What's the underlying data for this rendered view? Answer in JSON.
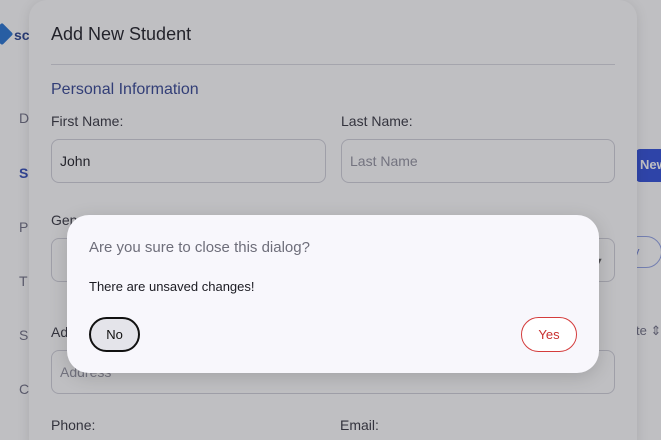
{
  "background_app": {
    "brand_text": "sc",
    "nav_letters": [
      "D",
      "S",
      "P",
      "T",
      "S",
      "C"
    ],
    "active_nav_index": 1,
    "new_button_label": "New",
    "outline_button_label": "y",
    "sort_label": "te"
  },
  "form_dialog": {
    "title": "Add New Student",
    "section_title": "Personal Information",
    "first_name": {
      "label": "First Name:",
      "value": "John"
    },
    "last_name": {
      "label": "Last Name:",
      "placeholder": "Last Name"
    },
    "gender": {
      "label": "Gen"
    },
    "address": {
      "label": "Ad",
      "placeholder": "Address"
    },
    "phone": {
      "label": "Phone:"
    },
    "email": {
      "label": "Email:"
    }
  },
  "confirm_dialog": {
    "title": "Are you sure to close this dialog?",
    "message": "There are unsaved changes!",
    "no_label": "No",
    "yes_label": "Yes"
  },
  "colors": {
    "accent": "#2848d8",
    "section_title": "#2e3f8f",
    "danger": "#d43c3c",
    "overlay": "rgba(60,60,70,0.33)"
  },
  "icons": {
    "logo": "diamond-logo-icon",
    "select_chevron": "chevron-down-icon",
    "sort_chevron": "sort-chevron-icon"
  }
}
